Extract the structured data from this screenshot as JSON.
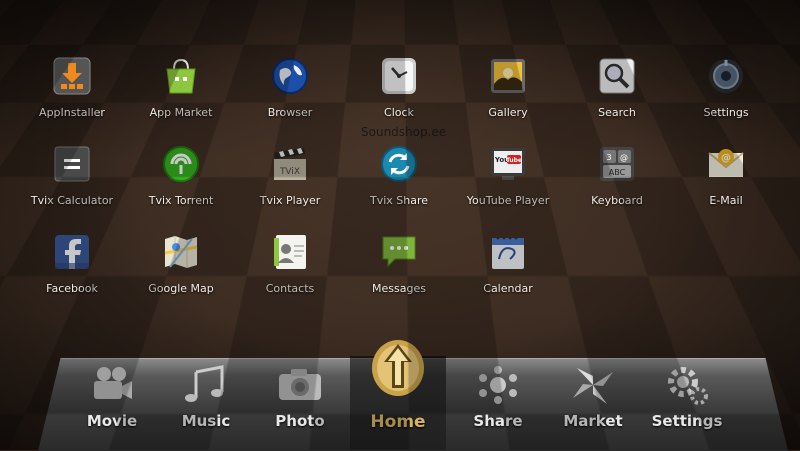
{
  "watermark": "Soundshop.ee",
  "apps": [
    {
      "label": "AppInstaller",
      "icon": "download-box-icon"
    },
    {
      "label": "App Market",
      "icon": "shopping-bag-icon"
    },
    {
      "label": "Browser",
      "icon": "globe-icon"
    },
    {
      "label": "Clock",
      "icon": "clock-icon"
    },
    {
      "label": "Gallery",
      "icon": "picture-icon"
    },
    {
      "label": "Search",
      "icon": "magnifier-icon"
    },
    {
      "label": "Settings",
      "icon": "settings-knob-icon"
    },
    {
      "label": "Tvix Calculator",
      "icon": "calculator-icon"
    },
    {
      "label": "Tvix Torrent",
      "icon": "torrent-icon"
    },
    {
      "label": "Tvix Player",
      "icon": "clapperboard-icon"
    },
    {
      "label": "Tvix Share",
      "icon": "sync-arrows-icon"
    },
    {
      "label": "YouTube Player",
      "icon": "youtube-tv-icon"
    },
    {
      "label": "Keyboard",
      "icon": "keyboard-keys-icon"
    },
    {
      "label": "E-Mail",
      "icon": "envelope-icon"
    },
    {
      "label": "Facebook",
      "icon": "facebook-icon"
    },
    {
      "label": "Google Map",
      "icon": "map-icon"
    },
    {
      "label": "Contacts",
      "icon": "contacts-book-icon"
    },
    {
      "label": "Messages",
      "icon": "speech-bubble-icon"
    },
    {
      "label": "Calendar",
      "icon": "calendar-icon"
    }
  ],
  "dock": [
    {
      "label": "Movie",
      "icon": "camera-reel-icon"
    },
    {
      "label": "Music",
      "icon": "music-notes-icon"
    },
    {
      "label": "Photo",
      "icon": "photo-camera-icon"
    },
    {
      "label": "Home",
      "icon": "home-arrow-icon",
      "active": true
    },
    {
      "label": "Share",
      "icon": "share-dots-icon"
    },
    {
      "label": "Market",
      "icon": "pinwheel-icon"
    },
    {
      "label": "Settings",
      "icon": "gears-icon"
    }
  ],
  "colors": {
    "accent_home": "#d8b35e",
    "label": "#f2ece6",
    "background": "#2e2119"
  }
}
